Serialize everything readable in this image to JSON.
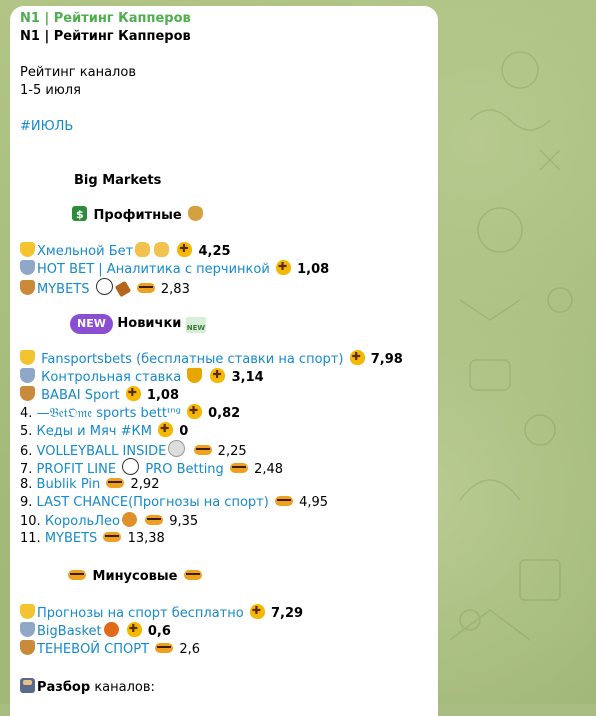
{
  "post": {
    "channel_name": "N1 | Рейтинг Капперов",
    "heading": "N1 | Рейтинг Капперов",
    "intro1": "Рейтинг каналов",
    "intro2": "1-5 июля",
    "hashtag": "#ИЮЛЬ",
    "section_title": "Big Markets",
    "profit_title": "Профитные",
    "profit_items": [
      {
        "name": "Хмельной Бет",
        "value": "4,25"
      },
      {
        "name": "HOT BET | Аналитика с перчинкой",
        "value": "1,08"
      },
      {
        "name": "MYBETS",
        "value": "2,83"
      }
    ],
    "new_badge": "NEW",
    "new_title": "Новички",
    "new_icon_text": "NEW",
    "new_items": [
      {
        "name": "Fansportsbets (бесплатные ставки на спорт)",
        "value": "7,98"
      },
      {
        "name": "Контрольная ставка",
        "value": "3,14"
      },
      {
        "name": "BABAI Sport",
        "value": "1,08"
      },
      {
        "prefix": "4.",
        "name": "—𝔅𝔢𝔱𝔒𝔪𝔢 sports bettᶦⁿᵍ",
        "value": "0,82"
      },
      {
        "prefix": "5.",
        "name": "Кеды и Мяч #КМ",
        "value": "0"
      },
      {
        "prefix": "6.",
        "name": "VOLLEYBALL INSIDE",
        "value": "2,25"
      },
      {
        "prefix": "7.",
        "name": "PROFIT LINE",
        "name2": "PRO Betting",
        "value": "2,48"
      },
      {
        "prefix": "8.",
        "name": "Bublik Pin",
        "value": "2,92"
      },
      {
        "prefix": "9.",
        "name": "LAST CHANCE(Прогнозы на спорт)",
        "value": "4,95"
      },
      {
        "prefix": "10.",
        "name": "КорольЛео",
        "value": "9,35"
      },
      {
        "prefix": "11.",
        "name": "MYBETS",
        "value": "13,38"
      }
    ],
    "minus_title": "Минусовые",
    "minus_items": [
      {
        "name": "Прогнозы на спорт бесплатно",
        "value": "7,29"
      },
      {
        "name": "BigBasket",
        "value": "0,6"
      },
      {
        "name": "ТЕНЕВОЙ СПОРТ",
        "value": "2,6"
      }
    ],
    "analysis_title": "Разбор",
    "analysis_rest": "каналов:"
  },
  "colors": {
    "link": "#168acd",
    "channel_name": "#4fae4e",
    "background": "#a9bd82",
    "bubble": "#ffffff"
  }
}
